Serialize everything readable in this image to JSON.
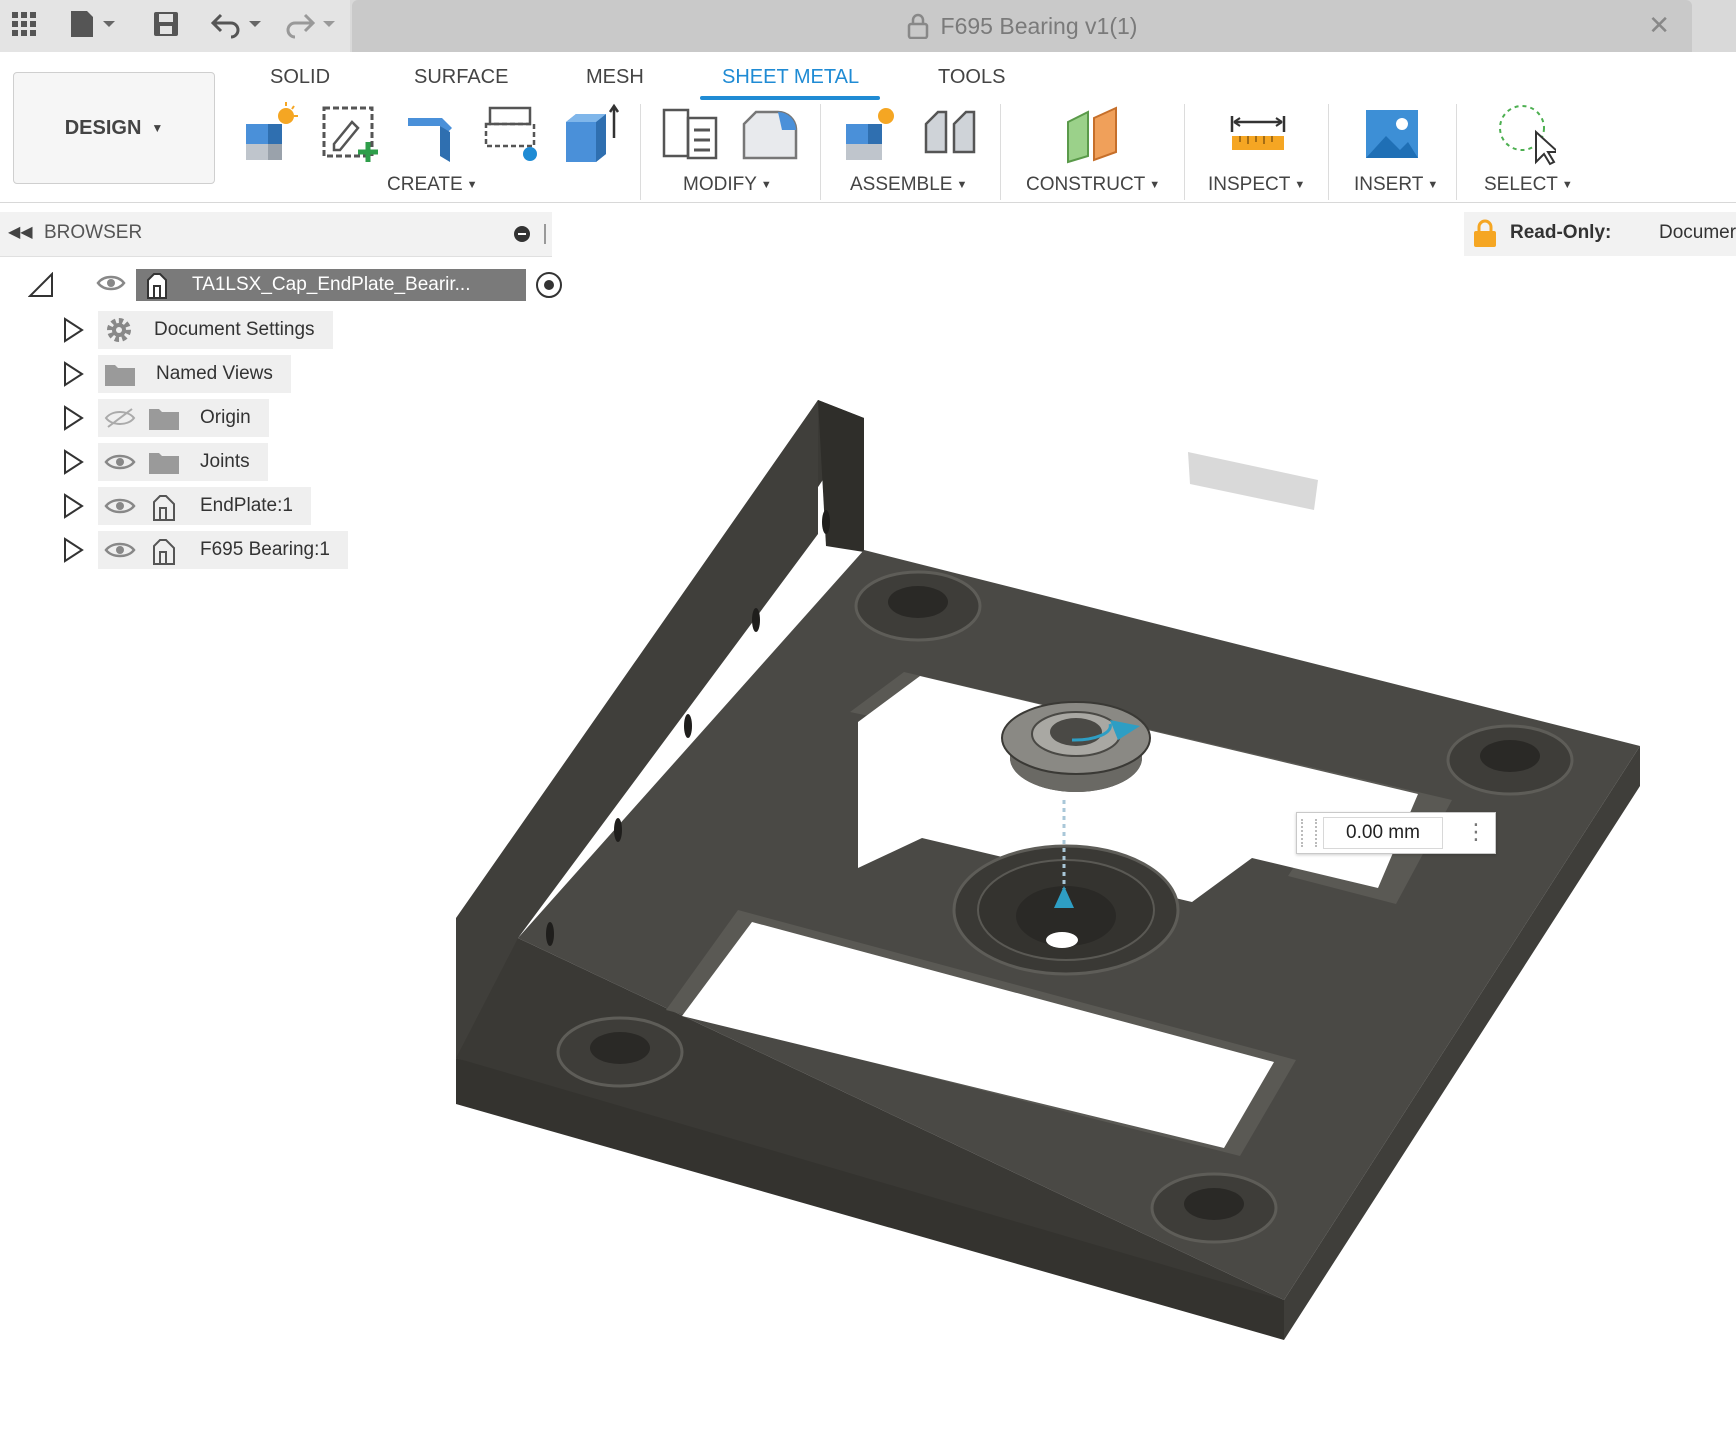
{
  "window": {
    "title": "F695 Bearing v1(1)"
  },
  "workspace": {
    "label": "DESIGN"
  },
  "tabs": [
    {
      "label": "SOLID"
    },
    {
      "label": "SURFACE"
    },
    {
      "label": "MESH"
    },
    {
      "label": "SHEET METAL",
      "active": true
    },
    {
      "label": "TOOLS"
    }
  ],
  "groups": {
    "create": "CREATE",
    "modify": "MODIFY",
    "assemble": "ASSEMBLE",
    "construct": "CONSTRUCT",
    "inspect": "INSPECT",
    "insert": "INSERT",
    "select": "SELECT"
  },
  "browser": {
    "title": "BROWSER",
    "root": "TA1LSX_Cap_EndPlate_Bearir...",
    "items": [
      {
        "label": "Document Settings",
        "icon": "gear-icon"
      },
      {
        "label": "Named Views",
        "icon": "folder-icon"
      },
      {
        "label": "Origin",
        "icon": "folder-icon",
        "visibility": "hidden"
      },
      {
        "label": "Joints",
        "icon": "folder-icon",
        "visibility": "visible"
      },
      {
        "label": "EndPlate:1",
        "icon": "component-icon",
        "visibility": "visible"
      },
      {
        "label": "F695 Bearing:1",
        "icon": "component-icon",
        "visibility": "visible"
      }
    ]
  },
  "status": {
    "readonly_label": "Read-Only:",
    "readonly_value": "Documer"
  },
  "manipulator": {
    "value": "0.00 mm"
  },
  "colors": {
    "accent": "#1f8bd4",
    "part": "#4a4945",
    "ribbon_bg": "#ffffff"
  }
}
